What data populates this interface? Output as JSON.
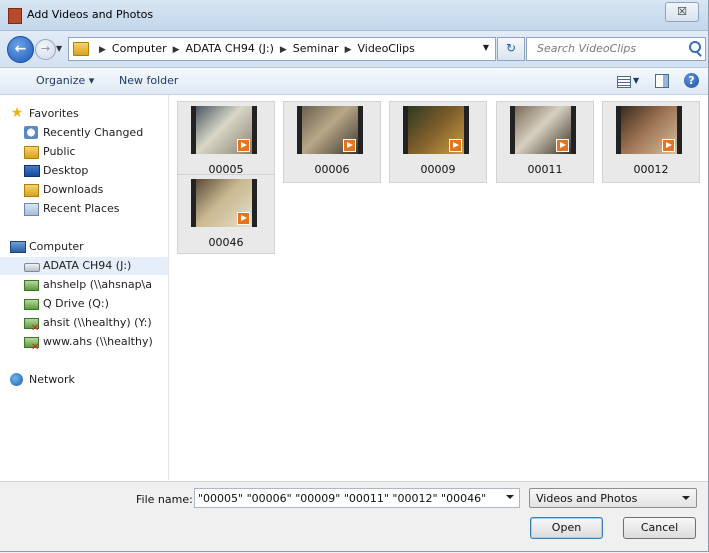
{
  "window": {
    "title": "Add Videos and Photos",
    "close_glyph": "☒"
  },
  "address": {
    "crumbs": [
      "Computer",
      "ADATA CH94 (J:)",
      "Seminar",
      "VideoClips"
    ],
    "search_placeholder": "Search VideoClips"
  },
  "toolbar": {
    "organize": "Organize ▾",
    "new_folder": "New folder"
  },
  "nav": {
    "favorites": "Favorites",
    "favorites_items": [
      "Recently Changed",
      "Public",
      "Desktop",
      "Downloads",
      "Recent Places"
    ],
    "computer": "Computer",
    "computer_items": [
      "ADATA CH94 (J:)",
      "ahshelp (\\\\ahsnap\\a",
      "Q Drive (Q:)",
      "ahsit (\\\\healthy) (Y:)",
      "www.ahs (\\\\healthy)"
    ],
    "network": "Network"
  },
  "files": [
    {
      "name": "00005",
      "colors": [
        "#4a5560",
        "#d8d8c8",
        "#8c8070"
      ]
    },
    {
      "name": "00006",
      "colors": [
        "#6a6050",
        "#b8a888",
        "#3c3830"
      ]
    },
    {
      "name": "00009",
      "colors": [
        "#2b3a22",
        "#7a5a2a",
        "#c8a040"
      ]
    },
    {
      "name": "00011",
      "colors": [
        "#7a6a58",
        "#d8d0c0",
        "#3a3028"
      ]
    },
    {
      "name": "00012",
      "colors": [
        "#3a2a20",
        "#9a7050",
        "#d8c0a0"
      ]
    },
    {
      "name": "00046",
      "colors": [
        "#5a4a38",
        "#c8b890",
        "#e8e0c8"
      ]
    }
  ],
  "bottom": {
    "file_name_label": "File name:",
    "file_name_value": "\"00005\" \"00006\" \"00009\" \"00011\" \"00012\" \"00046\"",
    "file_type": "Videos and Photos",
    "open": "Open",
    "cancel": "Cancel"
  }
}
